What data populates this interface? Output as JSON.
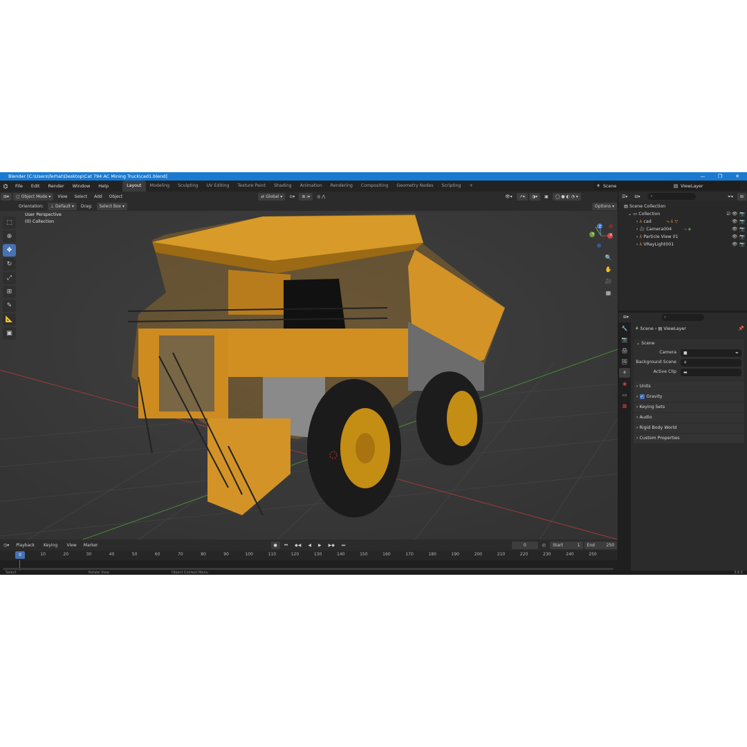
{
  "title_bar": {
    "text": "Blender [C:\\Users\\ferhat\\Desktop\\Cat 794 AC Mining Truck\\cad1.blend]",
    "minimize": "—",
    "maximize": "❐",
    "close": "✕"
  },
  "menu": {
    "items": [
      "File",
      "Edit",
      "Render",
      "Window",
      "Help"
    ],
    "workspaces": [
      "Layout",
      "Modeling",
      "Sculpting",
      "UV Editing",
      "Texture Paint",
      "Shading",
      "Animation",
      "Rendering",
      "Compositing",
      "Geometry Nodes",
      "Scripting"
    ],
    "active_workspace": "Layout",
    "add_tab": "+",
    "scene_label": "Scene",
    "viewlayer_label": "ViewLayer"
  },
  "viewport_header": {
    "mode": "Object Mode",
    "menus": [
      "View",
      "Select",
      "Add",
      "Object"
    ],
    "transform_orientation": "Global",
    "options_label": "Options"
  },
  "tool_settings": {
    "orientation_label": "Orientation:",
    "orientation_value": "Default",
    "drag_label": "Drag:",
    "drag_value": "Select Box"
  },
  "viewport": {
    "view_name": "User Perspective",
    "collection_info": "(0) Collection",
    "gizmo_axes": {
      "y": "Y",
      "x": "X",
      "z": "Z"
    }
  },
  "outliner": {
    "search_placeholder": "",
    "root": "Scene Collection",
    "collection": "Collection",
    "items": [
      "cad",
      "Camera004",
      "Particle View 01",
      "VRayLight001"
    ]
  },
  "properties": {
    "breadcrumb_scene": "Scene",
    "breadcrumb_viewlayer": "ViewLayer",
    "section_scene": "Scene",
    "camera_label": "Camera",
    "background_scene_label": "Background Scene",
    "active_clip_label": "Active Clip",
    "sections": [
      "Units",
      "Gravity",
      "Keying Sets",
      "Audio",
      "Rigid Body World",
      "Custom Properties"
    ],
    "gravity_checked": true
  },
  "timeline": {
    "menus": [
      "Playback",
      "Keying",
      "View",
      "Marker"
    ],
    "current_frame": "0",
    "start_label": "Start",
    "start_value": "1",
    "end_label": "End",
    "end_value": "250",
    "ticks": [
      "0",
      "10",
      "20",
      "30",
      "40",
      "50",
      "60",
      "70",
      "80",
      "90",
      "100",
      "110",
      "120",
      "130",
      "140",
      "150",
      "160",
      "170",
      "180",
      "190",
      "200",
      "210",
      "220",
      "230",
      "240",
      "250"
    ]
  },
  "statusbar": {
    "select": "Select",
    "rotate": "Rotate View",
    "context": "Object Context Menu",
    "version": "3.6.5"
  },
  "colors": {
    "accent_blue": "#4772b3",
    "truck_yellow": "#d89a28",
    "title_blue": "#1a7ad1",
    "grid_red": "#a03a3a",
    "grid_green": "#4e8a3a"
  }
}
